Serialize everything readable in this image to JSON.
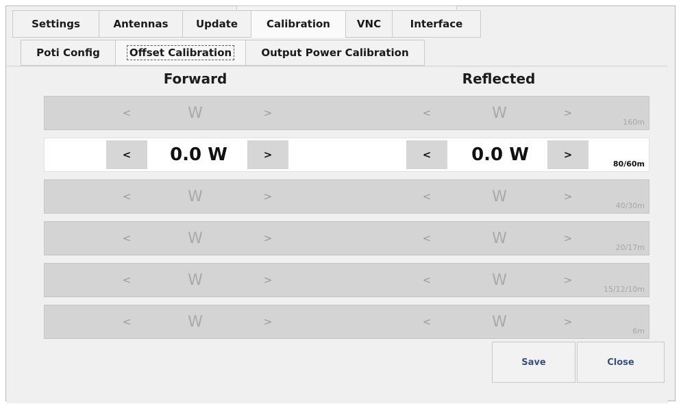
{
  "tabs": [
    {
      "label": "Settings"
    },
    {
      "label": "Antennas"
    },
    {
      "label": "Update"
    },
    {
      "label": "Calibration"
    },
    {
      "label": "VNC"
    },
    {
      "label": "Interface"
    }
  ],
  "active_tab": "Calibration",
  "subtabs": [
    {
      "label": "Poti Config"
    },
    {
      "label": "Offset Calibration"
    },
    {
      "label": "Output Power Calibration"
    }
  ],
  "active_subtab": "Offset Calibration",
  "headings": {
    "forward": "Forward",
    "reflected": "Reflected"
  },
  "arrows": {
    "prev": "<",
    "next": ">"
  },
  "rows": [
    {
      "band": "160m",
      "forward": "W",
      "reflected": "W",
      "active": false
    },
    {
      "band": "80/60m",
      "forward": "0.0 W",
      "reflected": "0.0 W",
      "active": true
    },
    {
      "band": "40/30m",
      "forward": "W",
      "reflected": "W",
      "active": false
    },
    {
      "band": "20/17m",
      "forward": "W",
      "reflected": "W",
      "active": false
    },
    {
      "band": "15/12/10m",
      "forward": "W",
      "reflected": "W",
      "active": false
    },
    {
      "band": "6m",
      "forward": "W",
      "reflected": "W",
      "active": false
    }
  ],
  "buttons": {
    "save": "Save",
    "close": "Close"
  }
}
